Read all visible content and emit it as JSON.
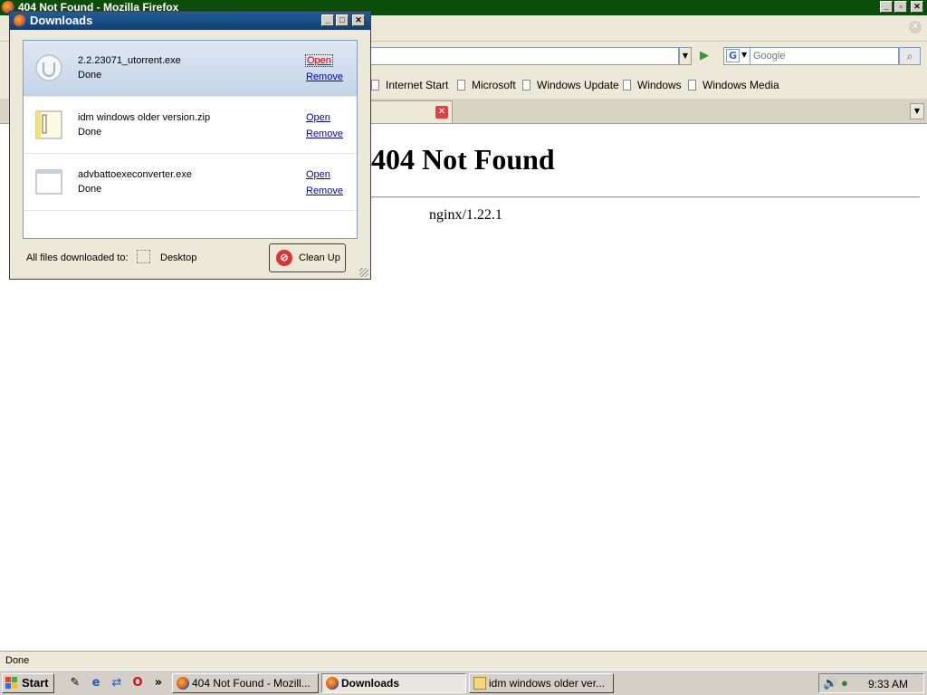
{
  "firefox": {
    "title": "404 Not Found - Mozilla Firefox",
    "url": "",
    "search": {
      "placeholder": "Google"
    },
    "bookmarks": [
      "Internet Start",
      "Microsoft",
      "Windows Update",
      "Windows",
      "Windows Media"
    ],
    "page": {
      "heading": "404 Not Found",
      "server": "nginx/1.22.1"
    },
    "status": "Done"
  },
  "downloads": {
    "title": "Downloads",
    "items": [
      {
        "name": "2.2.23071_utorrent.exe",
        "status": "Done",
        "open": "Open",
        "remove": "Remove"
      },
      {
        "name": "idm windows older version.zip",
        "status": "Done",
        "open": "Open",
        "remove": "Remove"
      },
      {
        "name": "advbattoexeconverter.exe",
        "status": "Done",
        "open": "Open",
        "remove": "Remove"
      }
    ],
    "footer_label": "All files downloaded to:",
    "folder": "Desktop",
    "cleanup_label": "Clean Up"
  },
  "taskbar": {
    "start": "Start",
    "more": "»",
    "tasks": [
      "404 Not Found - Mozill...",
      "Downloads",
      "idm windows older ver..."
    ],
    "clock": "9:33 AM"
  },
  "colors": {
    "ff_titlebar": "#0a4e0a",
    "dl_titlebar": "#1f5d9a",
    "link": "#0000cc",
    "link_hot": "#cc0000"
  }
}
